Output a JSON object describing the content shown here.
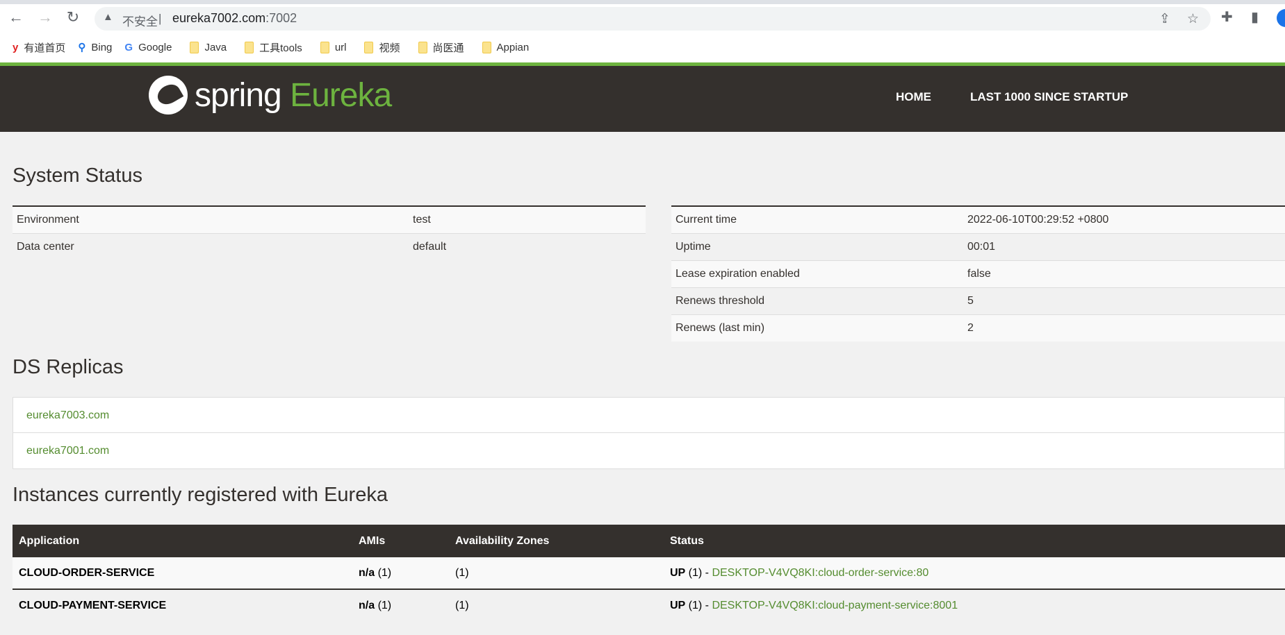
{
  "browser": {
    "insecure_label": "不安全",
    "url_host": "eureka7002.com",
    "url_port": ":7002",
    "bookmarks": [
      {
        "label": "有道首页",
        "icon": "youdao-icon"
      },
      {
        "label": "Bing",
        "icon": "bing-icon"
      },
      {
        "label": "Google",
        "icon": "google-icon"
      },
      {
        "label": "Java",
        "icon": "folder-icon"
      },
      {
        "label": "工具tools",
        "icon": "folder-icon"
      },
      {
        "label": "url",
        "icon": "folder-icon"
      },
      {
        "label": "视频",
        "icon": "folder-icon"
      },
      {
        "label": "尚医通",
        "icon": "folder-icon"
      },
      {
        "label": "Appian",
        "icon": "folder-icon"
      }
    ]
  },
  "header": {
    "logo_spring": "spring",
    "logo_eureka": "Eureka",
    "nav": [
      "HOME",
      "LAST 1000 SINCE STARTUP"
    ]
  },
  "system_status": {
    "title": "System Status",
    "left": [
      [
        "Environment",
        "test"
      ],
      [
        "Data center",
        "default"
      ]
    ],
    "right": [
      [
        "Current time",
        "2022-06-10T00:29:52 +0800"
      ],
      [
        "Uptime",
        "00:01"
      ],
      [
        "Lease expiration enabled",
        "false"
      ],
      [
        "Renews threshold",
        "5"
      ],
      [
        "Renews (last min)",
        "2"
      ]
    ]
  },
  "replicas": {
    "title": "DS Replicas",
    "items": [
      "eureka7003.com",
      "eureka7001.com"
    ]
  },
  "instances": {
    "title": "Instances currently registered with Eureka",
    "columns": [
      "Application",
      "AMIs",
      "Availability Zones",
      "Status"
    ],
    "rows": [
      {
        "app": "CLOUD-ORDER-SERVICE",
        "ami_b": "n/a",
        "ami": " (1)",
        "zones": "(1)",
        "status_b": "UP",
        "status": " (1) - ",
        "link": "DESKTOP-V4VQ8KI:cloud-order-service:80"
      },
      {
        "app": "CLOUD-PAYMENT-SERVICE",
        "ami_b": "n/a",
        "ami": " (1)",
        "zones": "(1)",
        "status_b": "UP",
        "status": " (1) - ",
        "link": "DESKTOP-V4VQ8KI:cloud-payment-service:8001"
      }
    ]
  },
  "colors": {
    "accent": "#6db33f",
    "header": "#34302d",
    "link": "#548c2f"
  }
}
